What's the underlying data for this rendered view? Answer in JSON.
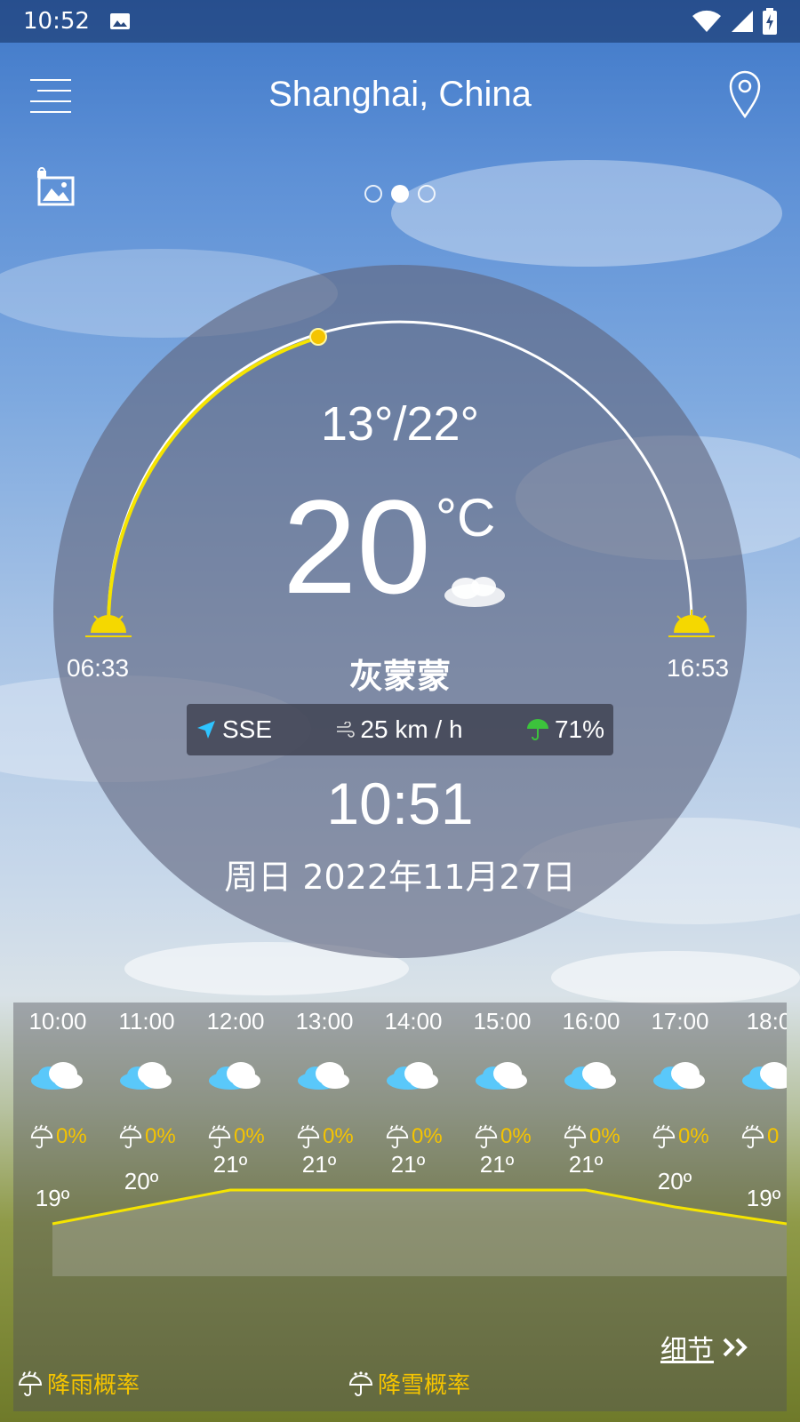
{
  "status_bar": {
    "time": "10:52"
  },
  "header": {
    "title": "Shanghai, China"
  },
  "pager": {
    "pages": 3,
    "active": 1
  },
  "sun": {
    "sunrise": "06:33",
    "sunset": "16:53"
  },
  "current": {
    "hi_lo": "13°/22°",
    "temperature": "20",
    "unit": "°C",
    "condition": "灰蒙蒙",
    "wind_direction": "SSE",
    "wind_speed": "25 km / h",
    "precipitation": "71%",
    "time": "10:51",
    "date": "周日 2022年11月27日"
  },
  "hourly": [
    {
      "time": "10:00",
      "rain": "0%",
      "temp": "19º"
    },
    {
      "time": "11:00",
      "rain": "0%",
      "temp": "20º"
    },
    {
      "time": "12:00",
      "rain": "0%",
      "temp": "21º"
    },
    {
      "time": "13:00",
      "rain": "0%",
      "temp": "21º"
    },
    {
      "time": "14:00",
      "rain": "0%",
      "temp": "21º"
    },
    {
      "time": "15:00",
      "rain": "0%",
      "temp": "21º"
    },
    {
      "time": "16:00",
      "rain": "0%",
      "temp": "21º"
    },
    {
      "time": "17:00",
      "rain": "0%",
      "temp": "20º"
    },
    {
      "time": "18:0",
      "rain": "0",
      "temp": "19º"
    }
  ],
  "details_label": "细节",
  "legend": {
    "rain": "降雨概率",
    "snow": "降雪概率"
  },
  "colors": {
    "accent": "#f5e400",
    "rain_text": "#f5c400",
    "wind_icon": "#2ec4ff",
    "umbrella": "#3cc33c"
  }
}
